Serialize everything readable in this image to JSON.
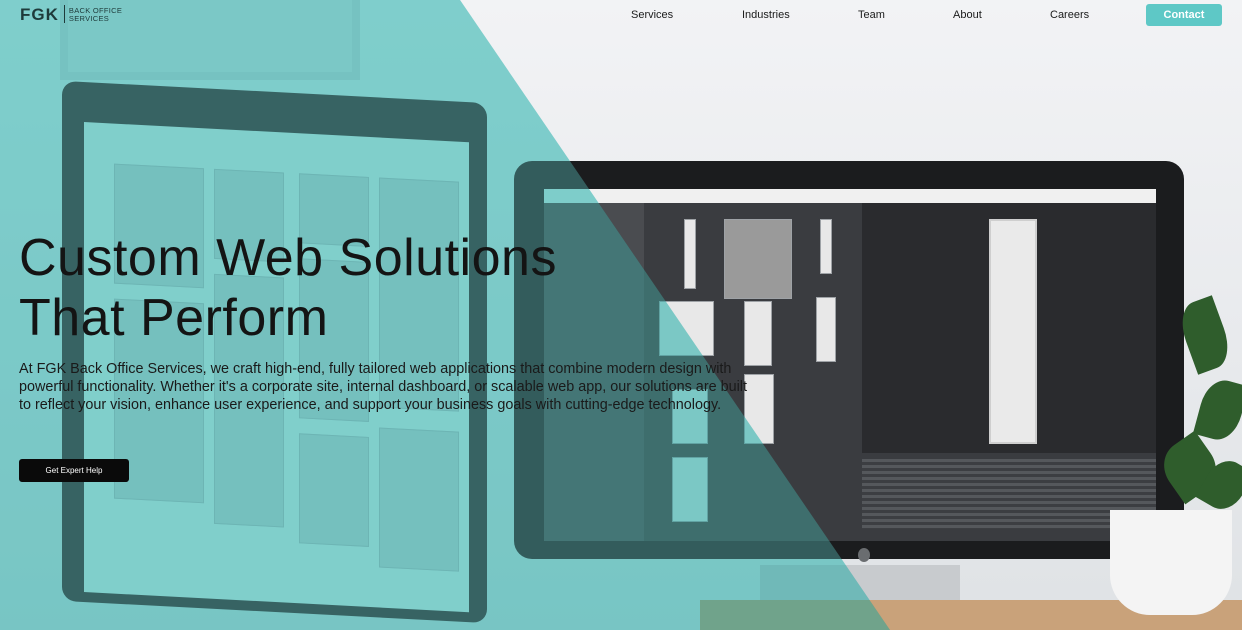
{
  "brand": {
    "mark": "FGK",
    "name_line1": "BACK OFFICE",
    "name_line2": "SERVICES"
  },
  "nav": {
    "items": [
      {
        "label": "Services"
      },
      {
        "label": "Industries"
      },
      {
        "label": "Team"
      },
      {
        "label": "About"
      },
      {
        "label": "Careers"
      }
    ],
    "contact_label": "Contact"
  },
  "hero": {
    "title_line1": "Custom Web Solutions",
    "title_line2": "That Perform",
    "description": "At FGK Back Office Services, we craft high-end, fully tailored web applications that combine modern design with powerful functionality. Whether it's a corporate site, internal dashboard, or scalable web app, our solutions are built to reflect your vision, enhance user experience, and support your business goals with cutting-edge technology.",
    "cta_label": "Get Expert Help"
  },
  "colors": {
    "accent": "#5ec8c6",
    "overlay": "#4ec4c0",
    "cta_bg": "#0a0a0a"
  }
}
